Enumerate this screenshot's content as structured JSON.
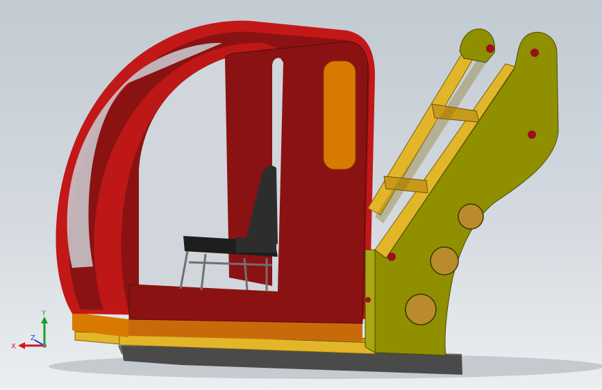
{
  "viewport": {
    "background_top": "#c2cad2",
    "background_bottom": "#eceff1"
  },
  "model": {
    "cab_color": "#8b1212",
    "cab_edge_color": "#c21818",
    "window_color": "#d97a00",
    "base_orange": "#c86a0a",
    "frame_color": "#8f8f00",
    "frame_light": "#a8a812",
    "rail_color": "#e3b62a",
    "skid_color": "#4a4a4a",
    "hole_color": "#b98b2c",
    "pin_color": "#9a1020",
    "seat_color": "#2d2d2d",
    "piston_color": "#e0307a"
  },
  "triad": {
    "x_label": "X",
    "y_label": "Y",
    "z_label": "Z",
    "x_color": "#d01818",
    "y_color": "#17a02a",
    "z_color": "#2040d0"
  }
}
